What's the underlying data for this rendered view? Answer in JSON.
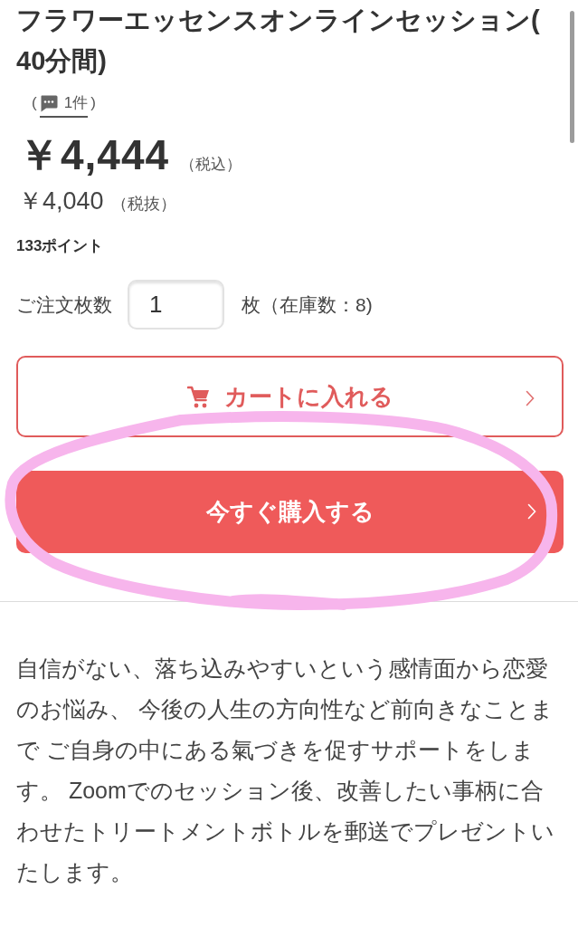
{
  "product": {
    "title": "フラワーエッセンスオンラインセッション(40分間)",
    "reviews": {
      "open": "(",
      "count": "1件",
      "close": ")"
    },
    "price": {
      "amount": "￥4,444",
      "note": "（税込）"
    },
    "price_excluding_tax": {
      "amount": "￥4,040",
      "note": "（税抜）"
    },
    "points": "133ポイント",
    "quantity": {
      "label": "ご注文枚数",
      "value": "1",
      "unit": "枚（在庫数：8)"
    }
  },
  "buttons": [
    {
      "kind": "cart",
      "label": "カートに入れる"
    },
    {
      "kind": "buy",
      "label": "今すぐ購入する"
    }
  ],
  "description": "自信がない、落ち込みやすいという感情面から恋愛のお悩み、 今後の人生の方向性など前向きなことまで ご自身の中にある氣づきを促すサポートをします。 Zoomでのセッション後、改善したい事柄に合わせたトリートメントボトルを郵送でプレゼントいたします。"
}
